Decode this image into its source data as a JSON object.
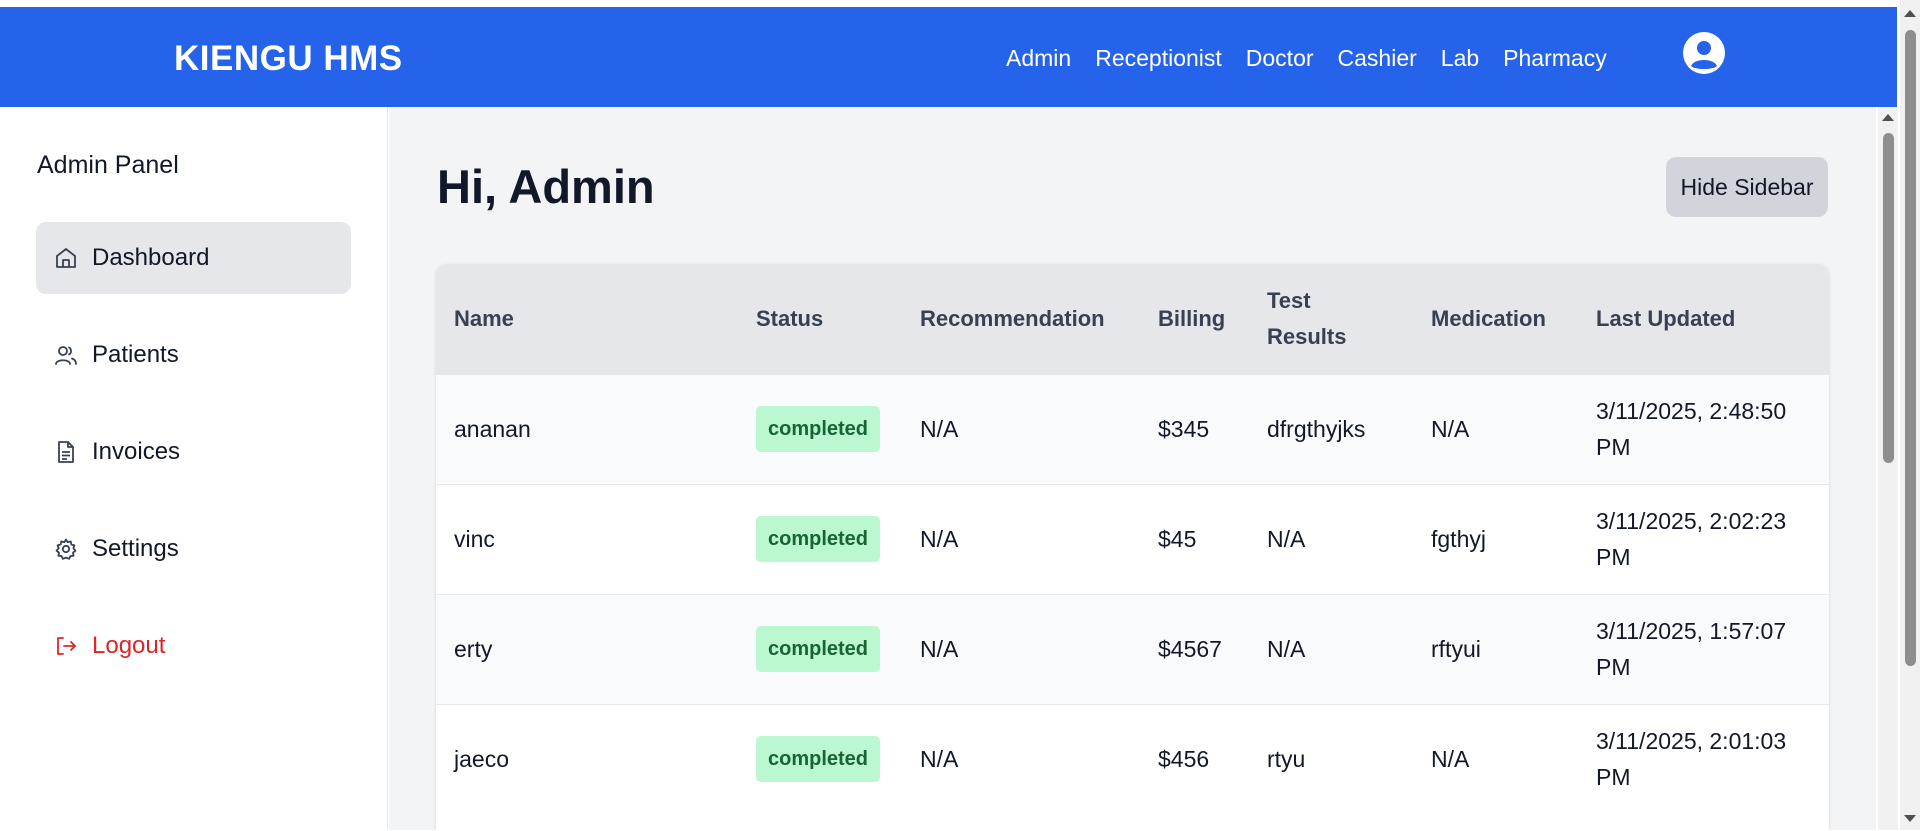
{
  "navbar": {
    "brand": "KIENGU HMS",
    "links": [
      "Admin",
      "Receptionist",
      "Doctor",
      "Cashier",
      "Lab",
      "Pharmacy"
    ]
  },
  "sidebar": {
    "title": "Admin Panel",
    "items": [
      {
        "label": "Dashboard",
        "icon": "home-icon"
      },
      {
        "label": "Patients",
        "icon": "users-icon"
      },
      {
        "label": "Invoices",
        "icon": "document-icon"
      },
      {
        "label": "Settings",
        "icon": "gear-icon"
      },
      {
        "label": "Logout",
        "icon": "logout-icon"
      }
    ]
  },
  "main": {
    "greeting": "Hi, Admin",
    "hide_sidebar_label": "Hide Sidebar"
  },
  "table": {
    "headers": [
      "Name",
      "Status",
      "Recommendation",
      "Billing",
      "Test Results",
      "Medication",
      "Last Updated"
    ],
    "rows": [
      [
        "ananan",
        "completed",
        "N/A",
        "$345",
        "dfrgthyjks",
        "N/A",
        "3/11/2025, 2:48:50 PM"
      ],
      [
        "vinc",
        "completed",
        "N/A",
        "$45",
        "N/A",
        "fgthyj",
        "3/11/2025, 2:02:23 PM"
      ],
      [
        "erty",
        "completed",
        "N/A",
        "$4567",
        "N/A",
        "rftyui",
        "3/11/2025, 1:57:07 PM"
      ],
      [
        "jaeco",
        "completed",
        "N/A",
        "$456",
        "rtyu",
        "N/A",
        "3/11/2025, 2:01:03 PM"
      ]
    ]
  },
  "colors": {
    "primary": "#2563eb",
    "badge_bg": "#bbf7d0",
    "badge_text": "#166534",
    "logout": "#dc2626"
  }
}
